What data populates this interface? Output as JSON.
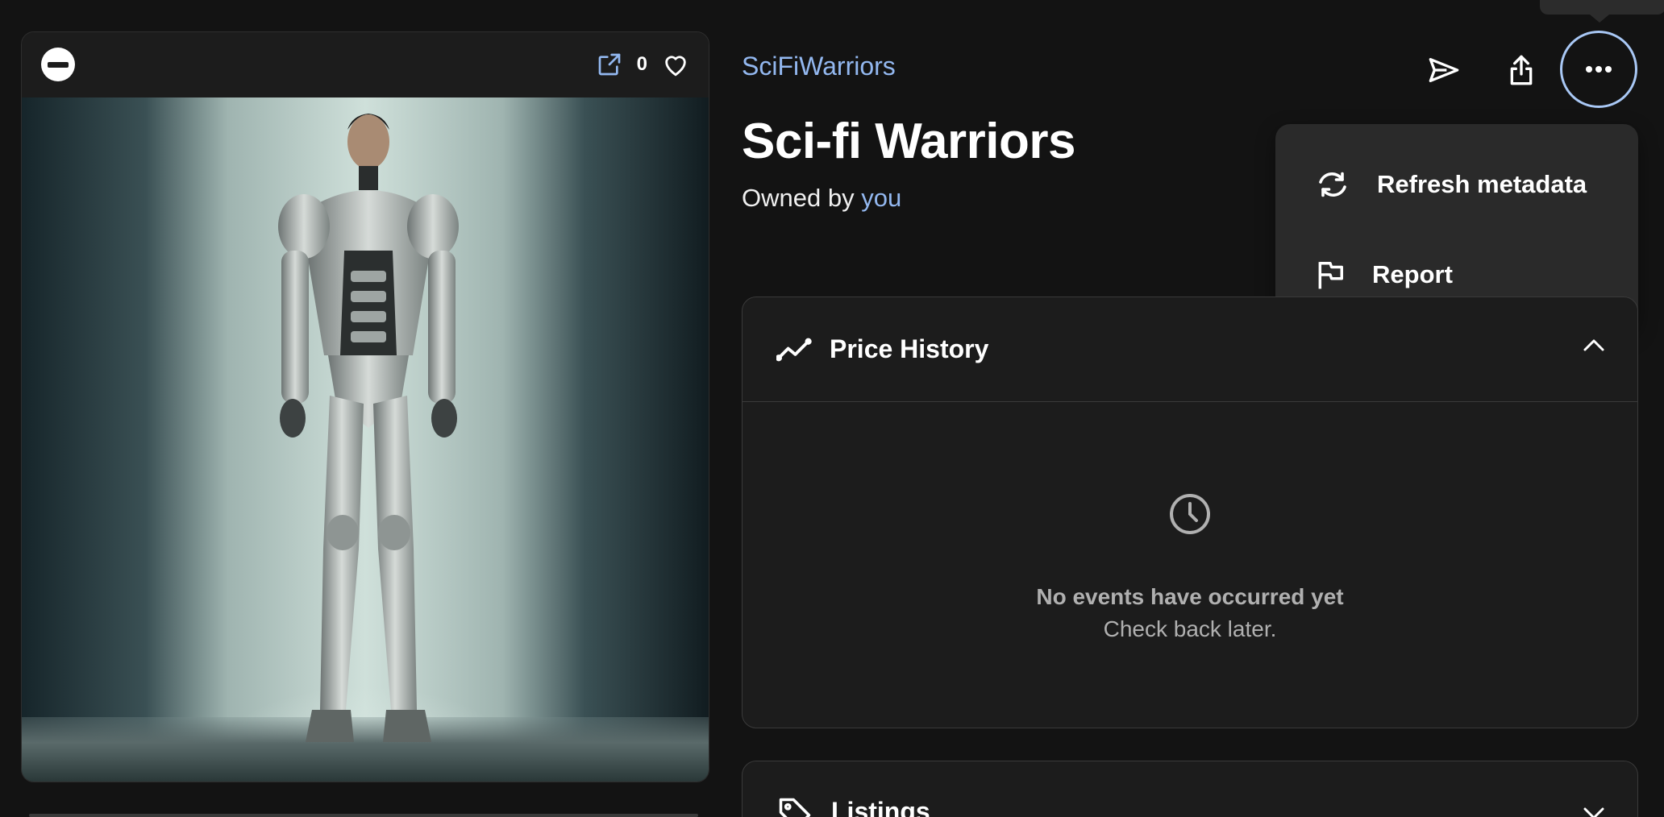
{
  "card": {
    "like_count": "0",
    "icons": [
      "chain-icon",
      "external-link-icon",
      "heart-icon"
    ]
  },
  "collection": {
    "name": "SciFiWarriors"
  },
  "item": {
    "title": "Sci-fi Warriors",
    "owned_prefix": "Owned by",
    "owner": "you"
  },
  "actions": {
    "icons": [
      "send-icon",
      "share-icon",
      "more-icon"
    ]
  },
  "menu": {
    "items": [
      {
        "label": "Refresh metadata",
        "icon": "refresh-icon"
      },
      {
        "label": "Report",
        "icon": "flag-icon"
      }
    ]
  },
  "price_history": {
    "title": "Price History",
    "empty_title": "No events have occurred yet",
    "empty_subtitle": "Check back later."
  },
  "listings": {
    "title": "Listings"
  },
  "colors": {
    "background": "#131313",
    "accent": "#93b8f0",
    "panel": "#1c1c1c",
    "menu": "#2a2a2a"
  }
}
